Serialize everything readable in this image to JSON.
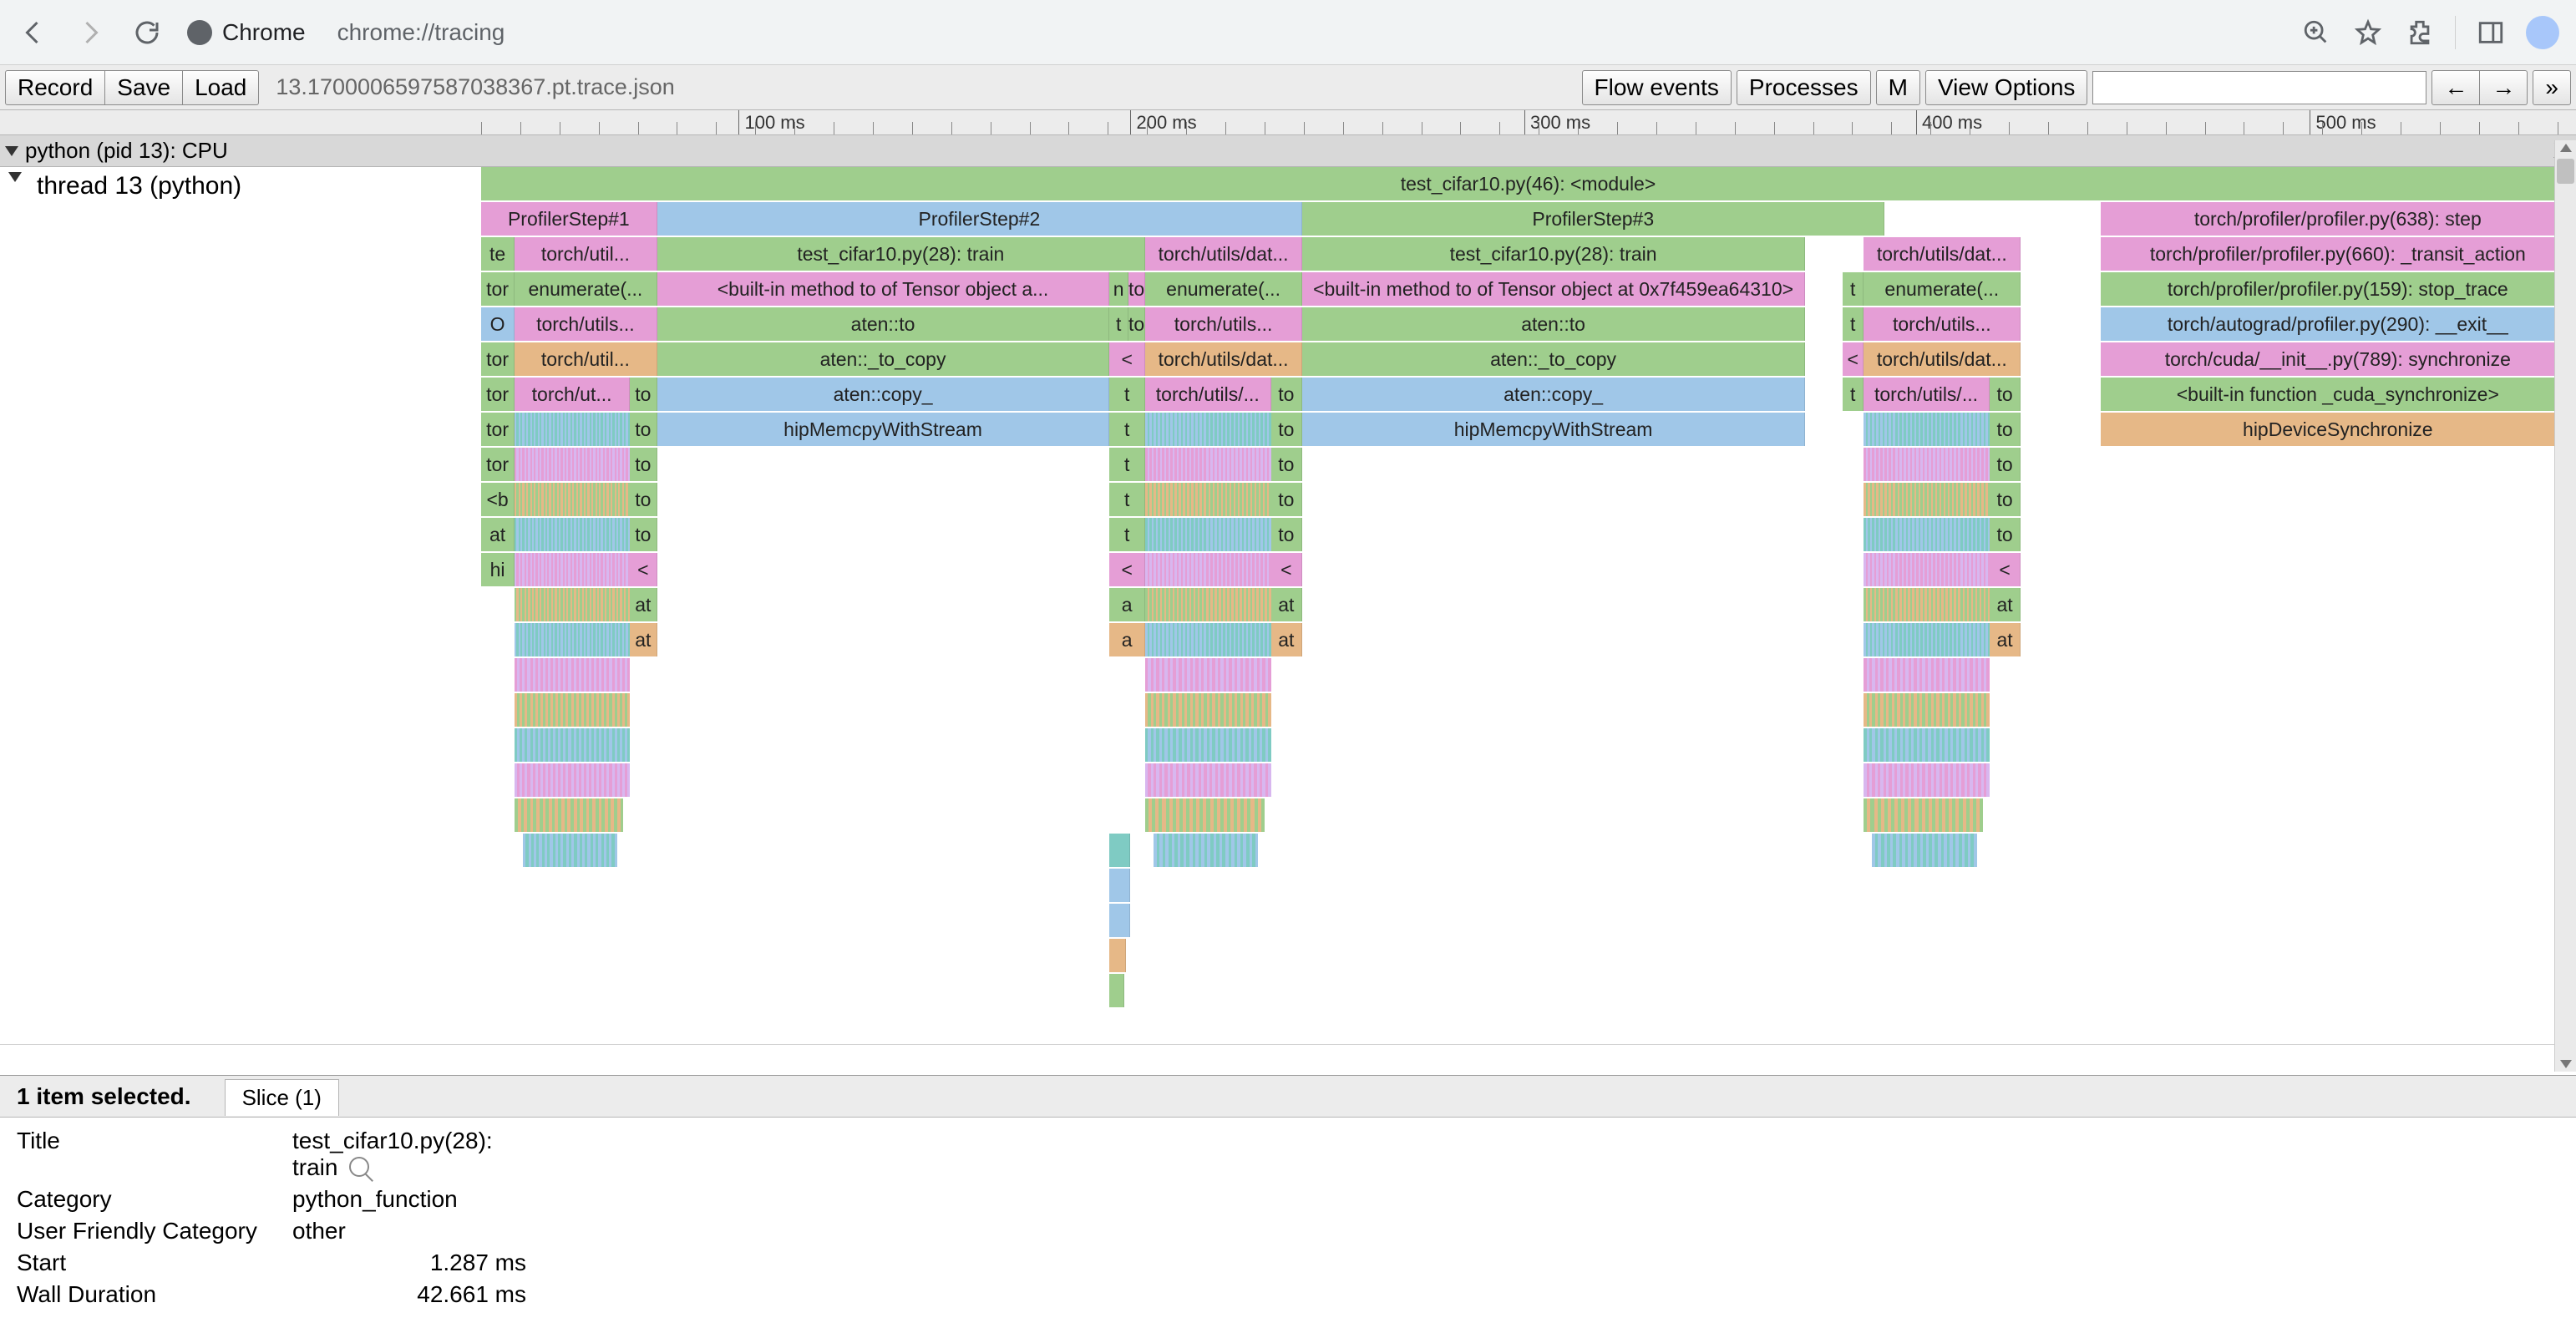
{
  "chrome": {
    "app_label": "Chrome",
    "url": "chrome://tracing"
  },
  "toolbar": {
    "record": "Record",
    "save": "Save",
    "load": "Load",
    "file": "13.1700006597587038367.pt.trace.json",
    "flow": "Flow events",
    "processes": "Processes",
    "m": "M",
    "view": "View Options",
    "left": "←",
    "right": "→",
    "more": "»"
  },
  "ruler": {
    "ticks": [
      {
        "label": "100 ms",
        "pct": 12.3
      },
      {
        "label": "200 ms",
        "pct": 31.0
      },
      {
        "label": "300 ms",
        "pct": 49.8
      },
      {
        "label": "400 ms",
        "pct": 68.5
      },
      {
        "label": "500 ms",
        "pct": 87.3
      }
    ]
  },
  "process": {
    "label": "python (pid 13): CPU",
    "close": "X"
  },
  "thread": {
    "label": "thread 13 (python)"
  },
  "slices": [
    [
      {
        "l": "test_cifar10.py(46): <module>",
        "left": 0,
        "w": 100,
        "c": "c-green"
      }
    ],
    [
      {
        "l": "ProfilerStep#1",
        "left": 0,
        "w": 8.4,
        "c": "c-pink"
      },
      {
        "l": "ProfilerStep#2",
        "left": 8.4,
        "w": 30.8,
        "c": "c-blue"
      },
      {
        "l": "ProfilerStep#3",
        "left": 39.2,
        "w": 27.8,
        "c": "c-green"
      },
      {
        "l": "torch/profiler/profiler.py(638): step",
        "left": 77.3,
        "w": 22.7,
        "c": "c-pink"
      }
    ],
    [
      {
        "l": "te",
        "left": 0,
        "w": 1.6,
        "c": "c-green"
      },
      {
        "l": "torch/util...",
        "left": 1.6,
        "w": 6.8,
        "c": "c-pink"
      },
      {
        "l": "test_cifar10.py(28): train",
        "left": 8.4,
        "w": 23.3,
        "c": "c-green"
      },
      {
        "l": "torch/utils/dat...",
        "left": 31.7,
        "w": 7.5,
        "c": "c-pink"
      },
      {
        "l": "test_cifar10.py(28): train",
        "left": 39.2,
        "w": 24.0,
        "c": "c-green"
      },
      {
        "l": "torch/utils/dat...",
        "left": 66.0,
        "w": 7.5,
        "c": "c-pink"
      },
      {
        "l": "torch/profiler/profiler.py(660): _transit_action",
        "left": 77.3,
        "w": 22.7,
        "c": "c-pink"
      }
    ],
    [
      {
        "l": "tor",
        "left": 0,
        "w": 1.6,
        "c": "c-green"
      },
      {
        "l": "enumerate(...",
        "left": 1.6,
        "w": 6.8,
        "c": "c-green"
      },
      {
        "l": "<built-in method to of Tensor object a...",
        "left": 8.4,
        "w": 21.6,
        "c": "c-pink"
      },
      {
        "l": "n",
        "left": 30.0,
        "w": 0.9,
        "c": "c-green"
      },
      {
        "l": "to",
        "left": 30.9,
        "w": 0.8,
        "c": "c-pink"
      },
      {
        "l": "enumerate(...",
        "left": 31.7,
        "w": 7.5,
        "c": "c-green"
      },
      {
        "l": "<built-in method to of Tensor object at 0x7f459ea64310>",
        "left": 39.2,
        "w": 24.0,
        "c": "c-pink"
      },
      {
        "l": "t",
        "left": 65.0,
        "w": 1.0,
        "c": "c-green"
      },
      {
        "l": "enumerate(...",
        "left": 66.0,
        "w": 7.5,
        "c": "c-green"
      },
      {
        "l": "torch/profiler/profiler.py(159): stop_trace",
        "left": 77.3,
        "w": 22.7,
        "c": "c-green"
      }
    ],
    [
      {
        "l": "O",
        "left": 0,
        "w": 1.6,
        "c": "c-blue"
      },
      {
        "l": "torch/utils...",
        "left": 1.6,
        "w": 6.8,
        "c": "c-pink"
      },
      {
        "l": "aten::to",
        "left": 8.4,
        "w": 21.6,
        "c": "c-green"
      },
      {
        "l": "t",
        "left": 30.0,
        "w": 0.9,
        "c": "c-green"
      },
      {
        "l": "to",
        "left": 30.9,
        "w": 0.8,
        "c": "c-green"
      },
      {
        "l": "torch/utils...",
        "left": 31.7,
        "w": 7.5,
        "c": "c-pink"
      },
      {
        "l": "aten::to",
        "left": 39.2,
        "w": 24.0,
        "c": "c-green"
      },
      {
        "l": "t",
        "left": 65.0,
        "w": 1.0,
        "c": "c-green"
      },
      {
        "l": "torch/utils...",
        "left": 66.0,
        "w": 7.5,
        "c": "c-pink"
      },
      {
        "l": "torch/autograd/profiler.py(290): __exit__",
        "left": 77.3,
        "w": 22.7,
        "c": "c-blue"
      }
    ],
    [
      {
        "l": "tor",
        "left": 0,
        "w": 1.6,
        "c": "c-green"
      },
      {
        "l": "torch/util...",
        "left": 1.6,
        "w": 6.8,
        "c": "c-tan"
      },
      {
        "l": "aten::_to_copy",
        "left": 8.4,
        "w": 21.6,
        "c": "c-green"
      },
      {
        "l": "<",
        "left": 30.0,
        "w": 1.7,
        "c": "c-pink"
      },
      {
        "l": "torch/utils/dat...",
        "left": 31.7,
        "w": 7.5,
        "c": "c-tan"
      },
      {
        "l": "aten::_to_copy",
        "left": 39.2,
        "w": 24.0,
        "c": "c-green"
      },
      {
        "l": "<",
        "left": 65.0,
        "w": 1.0,
        "c": "c-pink"
      },
      {
        "l": "torch/utils/dat...",
        "left": 66.0,
        "w": 7.5,
        "c": "c-tan"
      },
      {
        "l": "torch/cuda/__init__.py(789): synchronize",
        "left": 77.3,
        "w": 22.7,
        "c": "c-pink"
      }
    ],
    [
      {
        "l": "tor",
        "left": 0,
        "w": 1.6,
        "c": "c-green"
      },
      {
        "l": "torch/ut...",
        "left": 1.6,
        "w": 5.5,
        "c": "c-pink"
      },
      {
        "l": "to",
        "left": 7.1,
        "w": 1.3,
        "c": "c-green"
      },
      {
        "l": "aten::copy_",
        "left": 8.4,
        "w": 21.6,
        "c": "c-blue"
      },
      {
        "l": "t",
        "left": 30.0,
        "w": 1.7,
        "c": "c-green"
      },
      {
        "l": "torch/utils/...",
        "left": 31.7,
        "w": 6.0,
        "c": "c-pink"
      },
      {
        "l": "to",
        "left": 37.7,
        "w": 1.5,
        "c": "c-green"
      },
      {
        "l": "aten::copy_",
        "left": 39.2,
        "w": 24.0,
        "c": "c-blue"
      },
      {
        "l": "t",
        "left": 65.0,
        "w": 1.0,
        "c": "c-green"
      },
      {
        "l": "torch/utils/...",
        "left": 66.0,
        "w": 6.0,
        "c": "c-pink"
      },
      {
        "l": "to",
        "left": 72.0,
        "w": 1.5,
        "c": "c-green"
      },
      {
        "l": "<built-in function _cuda_synchronize>",
        "left": 77.3,
        "w": 22.7,
        "c": "c-green"
      }
    ],
    [
      {
        "l": "tor",
        "left": 0,
        "w": 1.6,
        "c": "c-green"
      },
      {
        "l": "",
        "left": 1.6,
        "w": 5.5,
        "c": "dense"
      },
      {
        "l": "to",
        "left": 7.1,
        "w": 1.3,
        "c": "c-green"
      },
      {
        "l": "hipMemcpyWithStream",
        "left": 8.4,
        "w": 21.6,
        "c": "c-blue"
      },
      {
        "l": "t",
        "left": 30.0,
        "w": 1.7,
        "c": "c-green"
      },
      {
        "l": "",
        "left": 31.7,
        "w": 6.0,
        "c": "dense"
      },
      {
        "l": "to",
        "left": 37.7,
        "w": 1.5,
        "c": "c-green"
      },
      {
        "l": "hipMemcpyWithStream",
        "left": 39.2,
        "w": 24.0,
        "c": "c-blue"
      },
      {
        "l": "",
        "left": 66.0,
        "w": 6.0,
        "c": "dense"
      },
      {
        "l": "to",
        "left": 72.0,
        "w": 1.5,
        "c": "c-green"
      },
      {
        "l": "hipDeviceSynchronize",
        "left": 77.3,
        "w": 22.7,
        "c": "c-tan"
      }
    ],
    [
      {
        "l": "tor",
        "left": 0,
        "w": 1.6,
        "c": "c-green"
      },
      {
        "l": "",
        "left": 1.6,
        "w": 5.5,
        "c": "dense"
      },
      {
        "l": "to",
        "left": 7.1,
        "w": 1.3,
        "c": "c-green"
      },
      {
        "l": "t",
        "left": 30.0,
        "w": 1.7,
        "c": "c-green"
      },
      {
        "l": "",
        "left": 31.7,
        "w": 6.0,
        "c": "dense"
      },
      {
        "l": "to",
        "left": 37.7,
        "w": 1.5,
        "c": "c-green"
      },
      {
        "l": "",
        "left": 66.0,
        "w": 6.0,
        "c": "dense"
      },
      {
        "l": "to",
        "left": 72.0,
        "w": 1.5,
        "c": "c-green"
      }
    ],
    [
      {
        "l": "<b",
        "left": 0,
        "w": 1.6,
        "c": "c-green"
      },
      {
        "l": "",
        "left": 1.6,
        "w": 5.5,
        "c": "dense"
      },
      {
        "l": "to",
        "left": 7.1,
        "w": 1.3,
        "c": "c-green"
      },
      {
        "l": "t",
        "left": 30.0,
        "w": 1.7,
        "c": "c-green"
      },
      {
        "l": "",
        "left": 31.7,
        "w": 6.0,
        "c": "dense"
      },
      {
        "l": "to",
        "left": 37.7,
        "w": 1.5,
        "c": "c-green"
      },
      {
        "l": "",
        "left": 66.0,
        "w": 6.0,
        "c": "dense"
      },
      {
        "l": "to",
        "left": 72.0,
        "w": 1.5,
        "c": "c-green"
      }
    ],
    [
      {
        "l": "at",
        "left": 0,
        "w": 1.6,
        "c": "c-green"
      },
      {
        "l": "",
        "left": 1.6,
        "w": 5.5,
        "c": "dense"
      },
      {
        "l": "to",
        "left": 7.1,
        "w": 1.3,
        "c": "c-green"
      },
      {
        "l": "t",
        "left": 30.0,
        "w": 1.7,
        "c": "c-green"
      },
      {
        "l": "",
        "left": 31.7,
        "w": 6.0,
        "c": "dense"
      },
      {
        "l": "to",
        "left": 37.7,
        "w": 1.5,
        "c": "c-green"
      },
      {
        "l": "",
        "left": 66.0,
        "w": 6.0,
        "c": "dense"
      },
      {
        "l": "to",
        "left": 72.0,
        "w": 1.5,
        "c": "c-green"
      }
    ],
    [
      {
        "l": "hi",
        "left": 0,
        "w": 1.6,
        "c": "c-green"
      },
      {
        "l": "",
        "left": 1.6,
        "w": 5.5,
        "c": "dense"
      },
      {
        "l": "<",
        "left": 7.1,
        "w": 1.3,
        "c": "c-pink"
      },
      {
        "l": "<",
        "left": 30.0,
        "w": 1.7,
        "c": "c-pink"
      },
      {
        "l": "",
        "left": 31.7,
        "w": 6.0,
        "c": "dense"
      },
      {
        "l": "<",
        "left": 37.7,
        "w": 1.5,
        "c": "c-pink"
      },
      {
        "l": "",
        "left": 66.0,
        "w": 6.0,
        "c": "dense"
      },
      {
        "l": "<",
        "left": 72.0,
        "w": 1.5,
        "c": "c-pink"
      }
    ],
    [
      {
        "l": "",
        "left": 1.6,
        "w": 5.5,
        "c": "dense"
      },
      {
        "l": "at",
        "left": 7.1,
        "w": 1.3,
        "c": "c-green"
      },
      {
        "l": "a",
        "left": 30.0,
        "w": 1.7,
        "c": "c-green"
      },
      {
        "l": "",
        "left": 31.7,
        "w": 6.0,
        "c": "dense"
      },
      {
        "l": "at",
        "left": 37.7,
        "w": 1.5,
        "c": "c-green"
      },
      {
        "l": "",
        "left": 66.0,
        "w": 6.0,
        "c": "dense"
      },
      {
        "l": "at",
        "left": 72.0,
        "w": 1.5,
        "c": "c-green"
      }
    ],
    [
      {
        "l": "",
        "left": 1.6,
        "w": 5.5,
        "c": "dense"
      },
      {
        "l": "at",
        "left": 7.1,
        "w": 1.3,
        "c": "c-tan"
      },
      {
        "l": "a",
        "left": 30.0,
        "w": 1.7,
        "c": "c-tan"
      },
      {
        "l": "",
        "left": 31.7,
        "w": 6.0,
        "c": "dense"
      },
      {
        "l": "at",
        "left": 37.7,
        "w": 1.5,
        "c": "c-tan"
      },
      {
        "l": "",
        "left": 66.0,
        "w": 6.0,
        "c": "dense"
      },
      {
        "l": "at",
        "left": 72.0,
        "w": 1.5,
        "c": "c-tan"
      }
    ],
    [
      {
        "l": "",
        "left": 1.6,
        "w": 5.5,
        "c": "dense2"
      },
      {
        "l": "",
        "left": 31.7,
        "w": 6.0,
        "c": "dense2"
      },
      {
        "l": "",
        "left": 66.0,
        "w": 6.0,
        "c": "dense2"
      }
    ],
    [
      {
        "l": "",
        "left": 1.6,
        "w": 5.5,
        "c": "dense2"
      },
      {
        "l": "",
        "left": 31.7,
        "w": 6.0,
        "c": "dense2"
      },
      {
        "l": "",
        "left": 66.0,
        "w": 6.0,
        "c": "dense2"
      }
    ],
    [
      {
        "l": "",
        "left": 1.6,
        "w": 5.5,
        "c": "dense2"
      },
      {
        "l": "",
        "left": 31.7,
        "w": 6.0,
        "c": "dense2"
      },
      {
        "l": "",
        "left": 66.0,
        "w": 6.0,
        "c": "dense2"
      }
    ],
    [
      {
        "l": "",
        "left": 1.6,
        "w": 5.5,
        "c": "dense2"
      },
      {
        "l": "",
        "left": 31.7,
        "w": 6.0,
        "c": "dense2"
      },
      {
        "l": "",
        "left": 66.0,
        "w": 6.0,
        "c": "dense2"
      }
    ],
    [
      {
        "l": "",
        "left": 1.6,
        "w": 5.2,
        "c": "dense3"
      },
      {
        "l": "",
        "left": 31.7,
        "w": 5.7,
        "c": "dense3"
      },
      {
        "l": "",
        "left": 66.0,
        "w": 5.7,
        "c": "dense3"
      }
    ],
    [
      {
        "l": "",
        "left": 2.0,
        "w": 4.5,
        "c": "dense3"
      },
      {
        "l": "",
        "left": 30.0,
        "w": 1.0,
        "c": "c-teal"
      },
      {
        "l": "",
        "left": 32.1,
        "w": 5.0,
        "c": "dense3"
      },
      {
        "l": "",
        "left": 66.4,
        "w": 5.0,
        "c": "dense3"
      }
    ],
    [
      {
        "l": "",
        "left": 30.0,
        "w": 1.0,
        "c": "c-pink"
      },
      {
        "l": "",
        "left": 30.0,
        "w": 1.0,
        "c": "c-blue"
      }
    ],
    [
      {
        "l": "",
        "left": 30.0,
        "w": 1.0,
        "c": "c-blue"
      }
    ],
    [
      {
        "l": "",
        "left": 30.0,
        "w": 0.8,
        "c": "c-tan"
      }
    ],
    [
      {
        "l": "",
        "left": 30.0,
        "w": 0.7,
        "c": "c-green"
      }
    ]
  ],
  "selection": {
    "header": "1 item selected.",
    "tab": "Slice (1)",
    "rows": [
      {
        "k": "Title",
        "v": "test_cifar10.py(28): train",
        "mag": true
      },
      {
        "k": "Category",
        "v": "python_function"
      },
      {
        "k": "User Friendly Category",
        "v": "other"
      },
      {
        "k": "Start",
        "v": "1.287 ms",
        "right": true
      },
      {
        "k": "Wall Duration",
        "v": "42.661 ms",
        "right": true
      }
    ]
  }
}
